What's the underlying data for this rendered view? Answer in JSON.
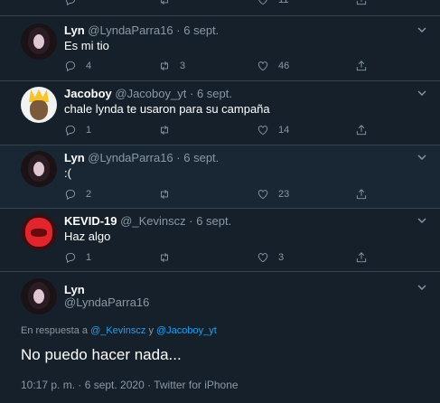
{
  "tweets": [
    {
      "name": "Lyn",
      "handle": "@LyndaParra16",
      "dot": "·",
      "date": "6 sept.",
      "text": "Es mi tio",
      "replies": "4",
      "retweets": "3",
      "likes": "46",
      "avatar_icon": "lyn-avatar"
    },
    {
      "name": "Jacoboy",
      "handle": "@Jacoboy_yt",
      "dot": "·",
      "date": "6 sept.",
      "text": "chale lynda te usaron para su campaña",
      "replies": "1",
      "retweets": "",
      "likes": "14",
      "avatar_icon": "jacoboy-avatar"
    },
    {
      "name": "Lyn",
      "handle": "@LyndaParra16",
      "dot": "·",
      "date": "6 sept.",
      "text": ":(",
      "replies": "2",
      "retweets": "",
      "likes": "23",
      "avatar_icon": "lyn-avatar"
    },
    {
      "name": "KEVID-19",
      "handle": "@_Kevinscz",
      "dot": "·",
      "date": "6 sept.",
      "text": "Haz algo",
      "replies": "1",
      "retweets": "",
      "likes": "3",
      "avatar_icon": "kevid-avatar"
    }
  ],
  "top_partial": {
    "likes": "11"
  },
  "main": {
    "name": "Lyn",
    "handle": "@LyndaParra16",
    "reply_prefix": "En respuesta a",
    "reply_user1": "@_Kevinscz",
    "reply_join": "y",
    "reply_user2": "@Jacoboy_yt",
    "text": "No puedo hacer nada...",
    "time": "10:17 p. m. · 6 sept. 2020 · Twitter for iPhone"
  },
  "colors": {
    "background": "#15202b",
    "highlight": "#192734",
    "accent": "#1da1f2",
    "muted": "#8899a6"
  }
}
